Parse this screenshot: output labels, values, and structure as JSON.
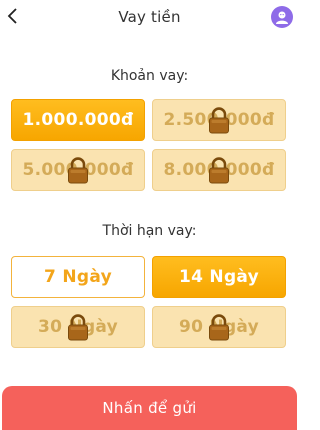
{
  "header": {
    "title": "Vay tiền"
  },
  "loan": {
    "label": "Khoản vay:",
    "options": [
      {
        "label": "1.000.000đ",
        "state": "selected"
      },
      {
        "label": "2.500.000đ",
        "state": "locked"
      },
      {
        "label": "5.000.000đ",
        "state": "locked"
      },
      {
        "label": "8.000.000đ",
        "state": "locked"
      }
    ]
  },
  "term": {
    "label": "Thời hạn vay:",
    "options": [
      {
        "label": "7 Ngày",
        "state": "normal"
      },
      {
        "label": "14 Ngày",
        "state": "selected"
      },
      {
        "label": "30 Ngày",
        "state": "locked"
      },
      {
        "label": "90 Ngày",
        "state": "locked"
      }
    ]
  },
  "submit": {
    "label": "Nhấn để gửi"
  },
  "colors": {
    "accent": "#f7a600",
    "locked_bg": "#fae3b0",
    "submit_bg": "#f5615b",
    "avatar": "#8e6be8"
  },
  "icons": {
    "back": "chevron-left-icon",
    "avatar": "avatar-icon",
    "lock": "lock-icon"
  }
}
